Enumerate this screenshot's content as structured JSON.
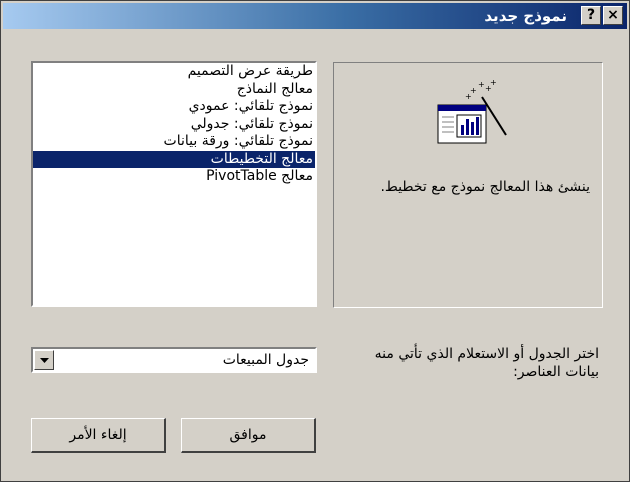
{
  "window": {
    "title": "نموذج جديد",
    "help_label": "?",
    "close_label": "×"
  },
  "list": {
    "items": [
      "طريقة عرض التصميم",
      "معالج النماذج",
      "نموذج تلقائي: عمودي",
      "نموذج تلقائي: جدولي",
      "نموذج تلقائي: ورقة بيانات",
      "معالج التخطيطات",
      "معالج PivotTable"
    ],
    "selected_index": 5
  },
  "preview": {
    "description": "ينشئ هذا المعالج نموذج مع تخطيط.",
    "icon": "chart-wizard-icon"
  },
  "source": {
    "prompt": "اختر الجدول أو الاستعلام الذي تأتي منه بيانات العناصر:",
    "selected": "جدول المبيعات"
  },
  "buttons": {
    "ok": "موافق",
    "cancel": "إلغاء الأمر"
  },
  "colors": {
    "selection": "#0a246a",
    "face": "#d4d0c8"
  }
}
